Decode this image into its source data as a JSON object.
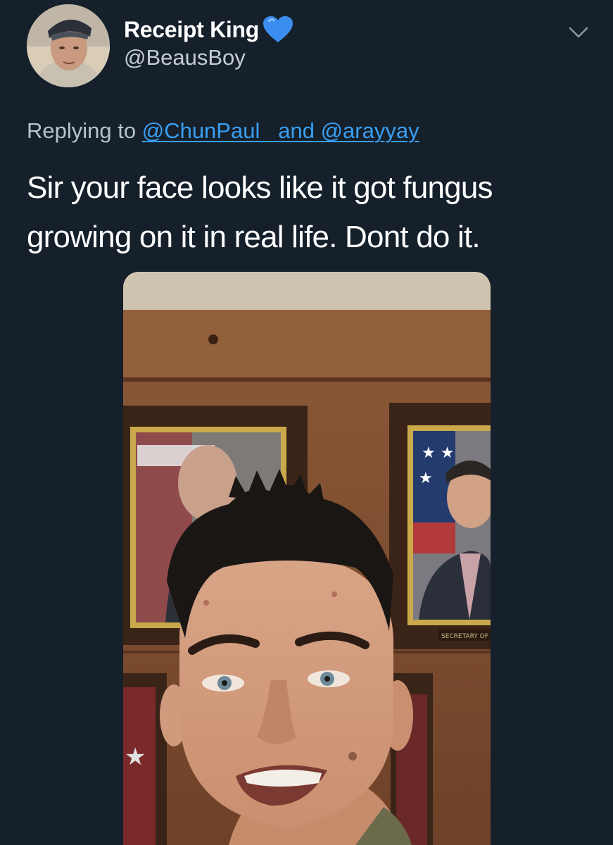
{
  "tweet": {
    "display_name": "Receipt King",
    "verified_emoji": "blue-heart",
    "handle": "@BeausBoy",
    "replying_prefix": "Replying to",
    "mention_1": "@ChunPaul_",
    "mention_joiner": "and",
    "mention_2": "@arayyay",
    "text_line_1": "Sir your face looks like it got fungus",
    "text_line_2": "growing on it in real life. Dont do it.",
    "photo_caption_plate": "SECRETARY OF"
  },
  "colors": {
    "background": "#15202b",
    "mention": "#3a9ff2",
    "heart": "#3b8ef0",
    "secondary_text": "#b8c2cc"
  },
  "icons": {
    "menu": "chevron-down-icon",
    "verified": "blue-heart-icon"
  }
}
